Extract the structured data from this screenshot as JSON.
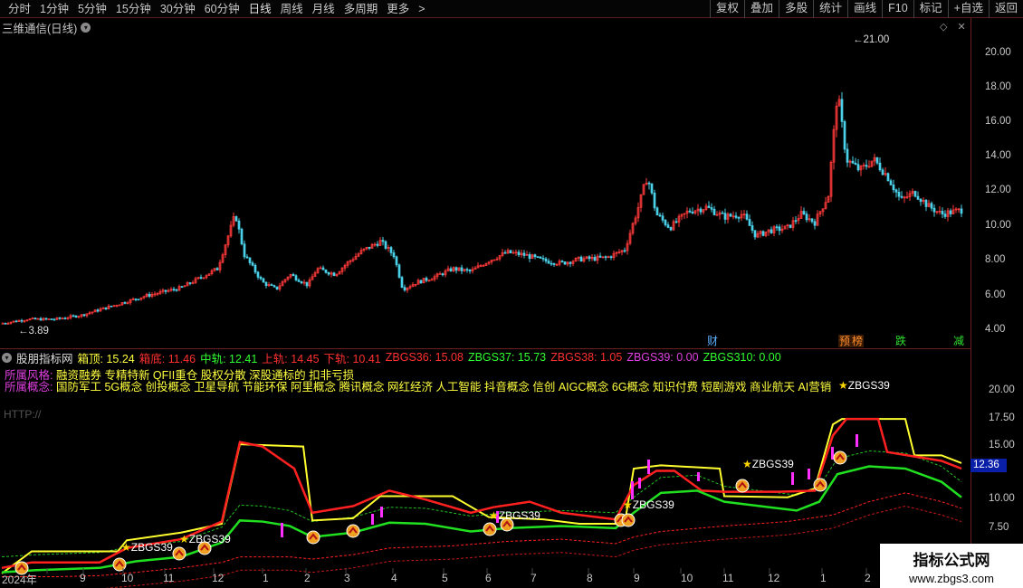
{
  "toolbar": {
    "periods": [
      "分时",
      "1分钟",
      "5分钟",
      "15分钟",
      "30分钟",
      "60分钟",
      "日线",
      "周线",
      "月线",
      "多周期",
      "更多"
    ],
    "active_period": "日线",
    "more_arrow": ">",
    "buttons": [
      "复权",
      "叠加",
      "多股",
      "统计",
      "画线",
      "F10",
      "标记",
      "+自选",
      "返回"
    ]
  },
  "stock": {
    "title": "三维通信(日线)"
  },
  "price_axis": {
    "main": [
      "20.00",
      "18.00",
      "16.00",
      "14.00",
      "12.00",
      "10.00",
      "8.00",
      "6.00",
      "4.00"
    ],
    "indicator": [
      "20.00",
      "17.50",
      "15.00",
      "12.36",
      "10.00",
      "7.50"
    ],
    "current_box": "12.36"
  },
  "annotations": {
    "high": "21.00",
    "low": "3.89"
  },
  "events": [
    {
      "text": "财",
      "color": "#5ab0ff"
    },
    {
      "text": "预",
      "color": "#ff9030"
    },
    {
      "text": "榜",
      "color": "#ff9030"
    },
    {
      "text": "跌",
      "color": "#30e030"
    },
    {
      "text": "减",
      "color": "#30e030"
    }
  ],
  "indicator": {
    "name": "股朋指标网",
    "values": [
      {
        "label": "箱顶: 15.24",
        "color": "#ffff40"
      },
      {
        "label": "箱底: 11.46",
        "color": "#ff3030"
      },
      {
        "label": "中轨: 12.41",
        "color": "#30ff30"
      },
      {
        "label": "上轨: 14.45",
        "color": "#ff3030"
      },
      {
        "label": "下轨: 10.41",
        "color": "#ff3030"
      },
      {
        "label": "ZBGS36: 15.08",
        "color": "#ff3030"
      },
      {
        "label": "ZBGS37: 15.73",
        "color": "#30ff30"
      },
      {
        "label": "ZBGS38: 1.05",
        "color": "#ff3030"
      },
      {
        "label": "ZBGS39: 0.00",
        "color": "#e040e0"
      },
      {
        "label": "ZBGS310: 0.00",
        "color": "#30ff30"
      }
    ],
    "style_label": "所属风格:",
    "style_value": "融资融券 专精特新 QFII重仓 股权分散 深股通标的 扣非亏损",
    "concept_label": "所属概念:",
    "concept_value": "国防军工 5G概念 创投概念 卫星导航 节能环保 阿里概念 腾讯概念 网红经济 人工智能 抖音概念 信创 AIGC概念 6G概念 知识付费 短剧游戏 商业航天 AI营销",
    "http": "HTTP://"
  },
  "zbgs_tag": "ZBGS39",
  "dates": [
    "2024年",
    "9",
    "10",
    "11",
    "12",
    "1",
    "2",
    "3",
    "4",
    "5",
    "6",
    "7",
    "8",
    "9",
    "10",
    "11",
    "12",
    "1",
    "2"
  ],
  "watermark": {
    "line1": "指标公式网",
    "line2": "www.zbgs3.com"
  },
  "colors": {
    "up": "#ff3a3a",
    "down": "#4ad0e8",
    "box_top": "#ffff30",
    "upper": "#ff2020",
    "mid": "#20e020"
  }
}
